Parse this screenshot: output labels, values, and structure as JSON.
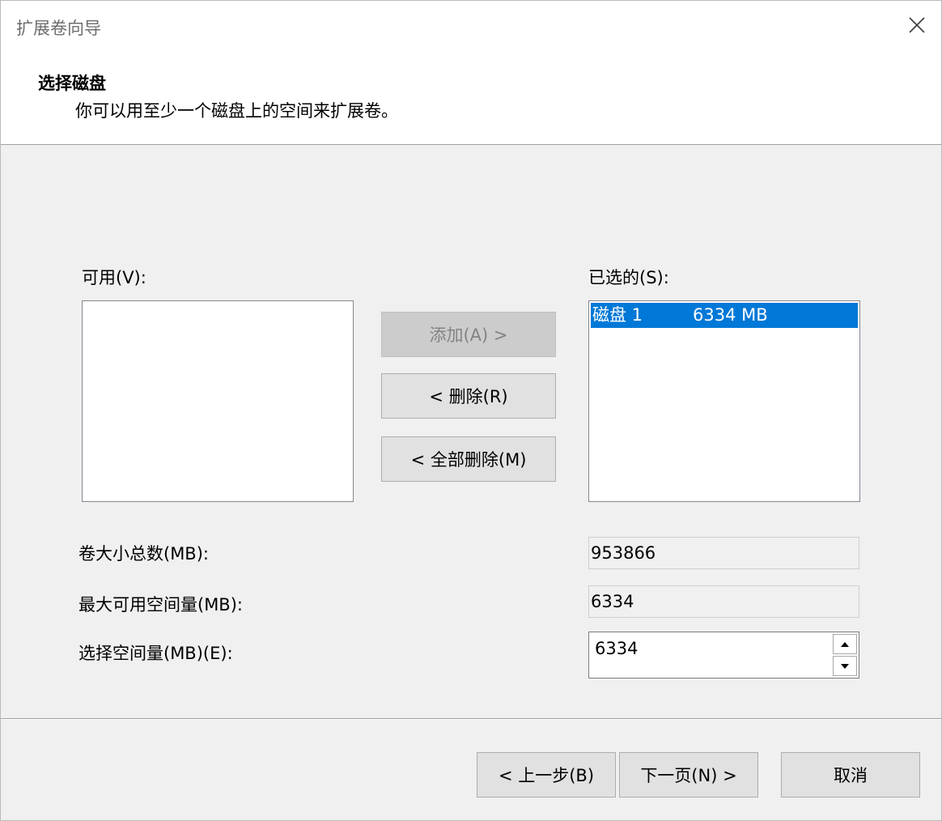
{
  "window": {
    "title": "扩展卷向导"
  },
  "header": {
    "title": "选择磁盘",
    "subtitle": "你可以用至少一个磁盘上的空间来扩展卷。"
  },
  "available": {
    "label": "可用(V):",
    "items": []
  },
  "selected": {
    "label": "已选的(S):",
    "items": [
      {
        "disk": "磁盘 1",
        "size": "6334 MB",
        "selected": true
      }
    ]
  },
  "buttons": {
    "add": "添加(A) >",
    "remove": "< 删除(R)",
    "remove_all": "< 全部删除(M)"
  },
  "fields": {
    "total_label": "卷大小总数(MB):",
    "total_value": "953866",
    "max_label": "最大可用空间量(MB):",
    "max_value": "6334",
    "select_label": "选择空间量(MB)(E):",
    "select_value": "6334"
  },
  "footer": {
    "back": "< 上一步(B)",
    "next": "下一页(N) >",
    "cancel": "取消"
  },
  "colors": {
    "selection": "#0078d7",
    "dialog_bg": "#f0f0f0"
  }
}
